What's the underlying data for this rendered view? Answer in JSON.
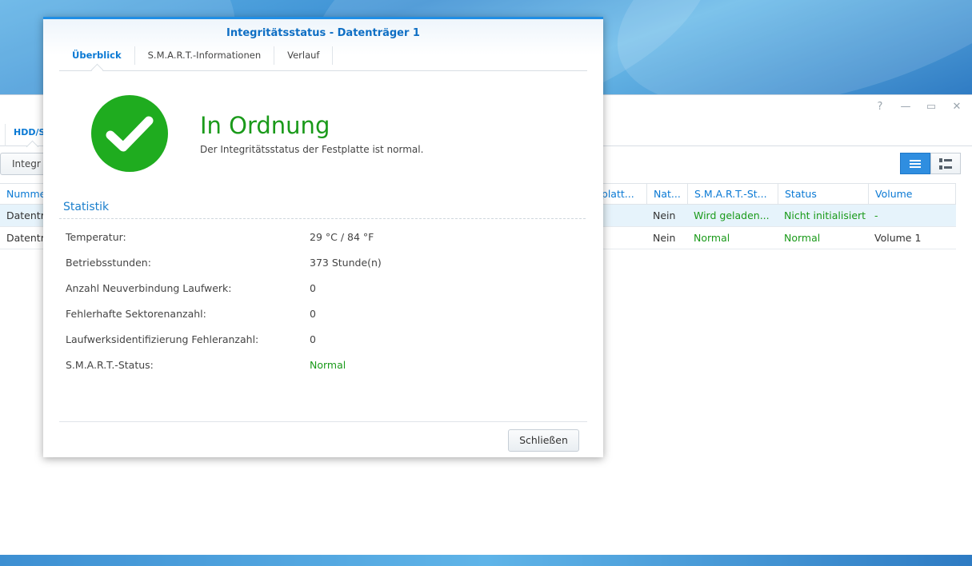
{
  "background_window": {
    "tab_label": "HDD/S",
    "toolbar_button": "Integr",
    "controls": [
      "?",
      "—",
      "▭",
      "✕"
    ],
    "table": {
      "headers": [
        "Numme",
        "tplatt...",
        "Nat...",
        "S.M.A.R.T.-St...",
        "Status",
        "Volume"
      ],
      "rows": [
        [
          "Datentr",
          "",
          "Nein",
          "Wird geladen...",
          "Nicht initialisiert",
          "-"
        ],
        [
          "Datentr",
          "",
          "Nein",
          "Normal",
          "Normal",
          "Volume 1"
        ]
      ]
    }
  },
  "modal": {
    "title": "Integritätsstatus - Datenträger 1",
    "tabs": [
      "Überblick",
      "S.M.A.R.T.-Informationen",
      "Verlauf"
    ],
    "status_title": "In Ordnung",
    "status_subtitle": "Der Integritätsstatus der Festplatte ist normal.",
    "section_title": "Statistik",
    "stats": [
      {
        "label": "Temperatur:",
        "value": "29 °C / 84 °F"
      },
      {
        "label": "Betriebsstunden:",
        "value": "373 Stunde(n)"
      },
      {
        "label": "Anzahl Neuverbindung Laufwerk:",
        "value": "0"
      },
      {
        "label": "Fehlerhafte Sektorenanzahl:",
        "value": "0"
      },
      {
        "label": "Laufwerksidentifizierung Fehleranzahl:",
        "value": "0"
      },
      {
        "label": "S.M.A.R.T.-Status:",
        "value": "Normal"
      }
    ],
    "close_label": "Schließen"
  },
  "colors": {
    "accent": "#0a79d4",
    "ok_green": "#1a9a1a",
    "check_circle": "#1fac1f"
  }
}
